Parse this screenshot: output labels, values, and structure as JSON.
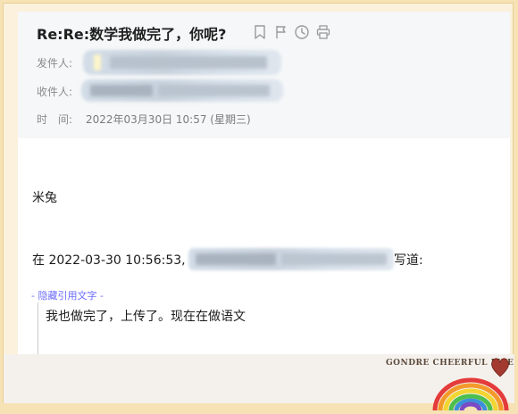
{
  "email": {
    "subject": "Re:Re:数学我做完了，你呢?",
    "labels": {
      "from": "发件人:",
      "to": "收件人:",
      "time": "时　间:"
    },
    "date": "2022年03月30日 10:57 (星期三)"
  },
  "toolbar": {
    "icons": [
      "bookmark-icon",
      "flag-icon",
      "clock-icon",
      "print-icon"
    ]
  },
  "body": {
    "greeting": "米兔",
    "quote_intro_prefix": "在 2022-03-30 10:56:53,",
    "quote_intro_suffix": "写道:",
    "hide_quote": "- 隐藏引用文字 -",
    "quoted_text": "我也做完了，上传了。现在在做语文"
  },
  "decor": {
    "brand_text": "GONDRE CHEERFUL LIFE",
    "heart_color": "#a33a2f"
  }
}
